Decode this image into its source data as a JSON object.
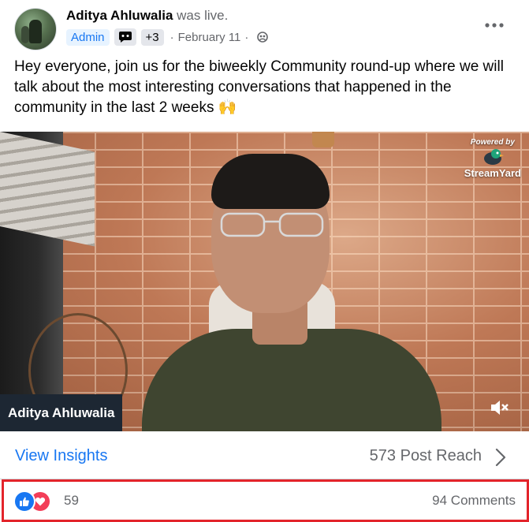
{
  "post": {
    "author": "Aditya Ahluwalia",
    "status_suffix": " was live.",
    "admin_badge": "Admin",
    "plus_badge": "+3",
    "date": "February 11",
    "dot": "·",
    "text": "Hey everyone, join us for the biweekly Community round-up where we will talk about the most interesting conversations that happened in the community in the last 2 weeks 🙌"
  },
  "video": {
    "powered_by": "Powered by",
    "brand": "StreamYard",
    "nameplate": "Aditya Ahluwalia"
  },
  "insights": {
    "view_label": "View Insights",
    "reach": "573 Post Reach"
  },
  "reactions": {
    "count": "59",
    "comments": "94 Comments"
  },
  "colors": {
    "link_blue": "#1877f2",
    "love_red": "#f33e58",
    "highlight_red": "#e3242b",
    "secondary_text": "#65676b"
  },
  "icons": [
    "more-options-icon",
    "group-badge-icon",
    "privacy-group-icon",
    "streamyard-logo-icon",
    "mute-icon",
    "chevron-right-icon",
    "like-reaction-icon",
    "love-reaction-icon"
  ]
}
